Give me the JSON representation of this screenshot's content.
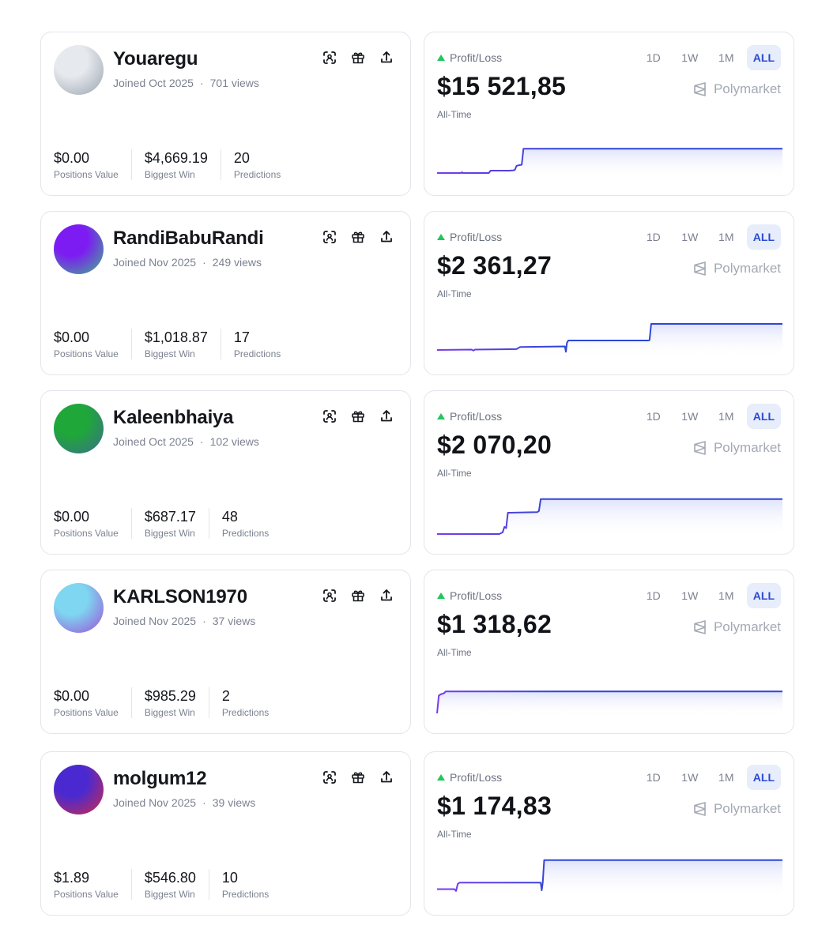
{
  "profiles": [
    {
      "username": "Youaregu",
      "joined": "Joined Oct 2025",
      "views": "701 views",
      "positions_value": "$0.00",
      "biggest_win": "$4,669.19",
      "predictions": "20",
      "pnl": "$15 521,85",
      "avatar_colors": [
        "#e6e9ee",
        "#9aa3ae"
      ]
    },
    {
      "username": "RandiBabuRandi",
      "joined": "Joined Nov 2025",
      "views": "249 views",
      "positions_value": "$0.00",
      "biggest_win": "$1,018.87",
      "predictions": "17",
      "pnl": "$2 361,27",
      "avatar_colors": [
        "#7c1cf2",
        "#3fb68a"
      ]
    },
    {
      "username": "Kaleenbhaiya",
      "joined": "Joined Oct 2025",
      "views": "102 views",
      "positions_value": "$0.00",
      "biggest_win": "$687.17",
      "predictions": "48",
      "pnl": "$2 070,20",
      "avatar_colors": [
        "#1fa73a",
        "#3b6f8c"
      ]
    },
    {
      "username": "KARLSON1970",
      "joined": "Joined Nov 2025",
      "views": "37 views",
      "positions_value": "$0.00",
      "biggest_win": "$985.29",
      "predictions": "2",
      "pnl": "$1 318,62",
      "avatar_colors": [
        "#7fd6f0",
        "#9a4fd8"
      ]
    },
    {
      "username": "molgum12",
      "joined": "Joined Nov 2025",
      "views": "39 views",
      "positions_value": "$1.89",
      "biggest_win": "$546.80",
      "predictions": "10",
      "pnl": "$1 174,83",
      "avatar_colors": [
        "#4a2ad0",
        "#d02a4a"
      ]
    }
  ],
  "labels": {
    "positions_value": "Positions Value",
    "biggest_win": "Biggest Win",
    "predictions": "Predictions",
    "pnl_title": "Profit/Loss",
    "all_time": "All-Time",
    "brand": "Polymarket",
    "view_separator": "·"
  },
  "tabs": [
    "1D",
    "1W",
    "1M",
    "ALL"
  ],
  "active_tab": "ALL",
  "icons": [
    "scan-icon",
    "gift-icon",
    "share-icon"
  ],
  "colors": {
    "line_start": "#7c3aed",
    "line_end": "#2f45d6",
    "area_fill": "#e9ebfb",
    "up_arrow": "#22c55e",
    "active_tab_bg": "#e8edfb",
    "active_tab_text": "#2b4ccf"
  },
  "chart_data": [
    {
      "type": "line",
      "title": "",
      "x": [
        0,
        7,
        7.2,
        7.4,
        15,
        15.5,
        21,
        22,
        22.5,
        23,
        23.5,
        24.5,
        25,
        100
      ],
      "y": [
        4,
        4,
        5.5,
        4,
        4,
        8,
        8,
        8.5,
        9,
        16,
        17,
        18,
        45,
        45
      ]
    },
    {
      "type": "line",
      "title": "",
      "x": [
        0,
        10,
        10.5,
        11,
        23,
        24,
        37,
        37.3,
        37.6,
        38,
        61,
        61.5,
        62,
        100
      ],
      "y": [
        8,
        8.6,
        7,
        8.6,
        9.5,
        13,
        14,
        5,
        20,
        24,
        24,
        24.5,
        52,
        52
      ]
    },
    {
      "type": "line",
      "title": "",
      "x": [
        0,
        18,
        19,
        19.5,
        20,
        20.5,
        21,
        29,
        29.5,
        30,
        100
      ],
      "y": [
        0,
        0,
        3,
        12,
        10,
        36,
        36,
        37,
        39,
        59,
        59
      ]
    },
    {
      "type": "line",
      "title": "",
      "x": [
        0,
        0.5,
        1,
        2,
        2.5,
        100
      ],
      "y": [
        0,
        30,
        32,
        34,
        37,
        37
      ]
    },
    {
      "type": "line",
      "title": "",
      "x": [
        0,
        5,
        5.5,
        6,
        6.5,
        7,
        30,
        30.3,
        30.6,
        31,
        100
      ],
      "y": [
        10,
        10,
        7,
        19,
        21,
        21,
        21,
        8,
        21,
        59,
        59
      ]
    }
  ]
}
